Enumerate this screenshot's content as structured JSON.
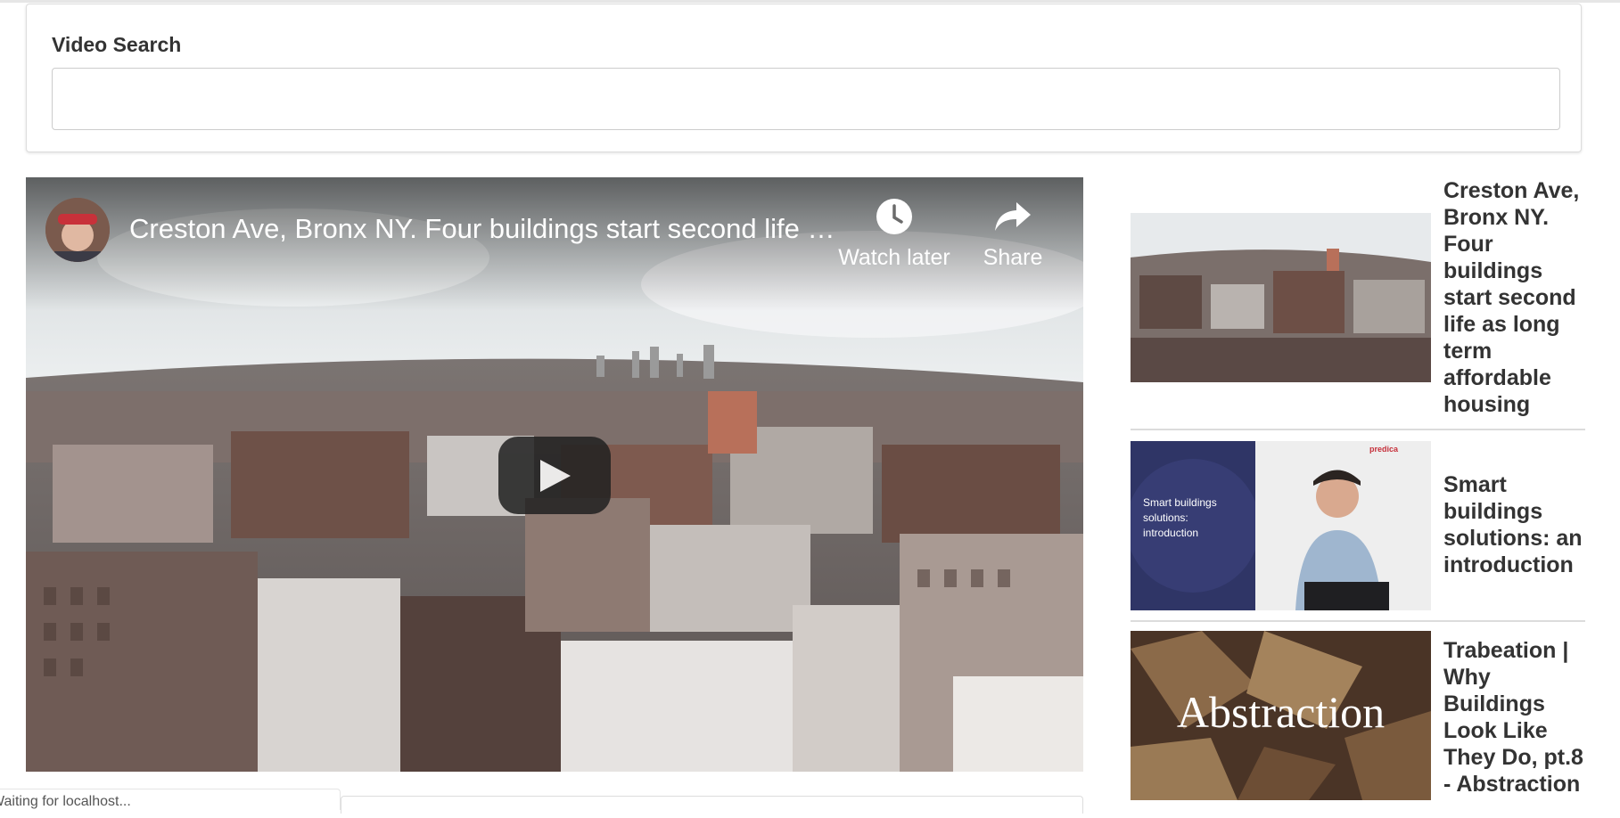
{
  "search": {
    "label": "Video Search",
    "value": "",
    "placeholder": ""
  },
  "player": {
    "title": "Creston Ave, Bronx NY. Four buildings start second life as long term affordable housing",
    "watch_later_label": "Watch later",
    "share_label": "Share",
    "icons": [
      "clock-icon",
      "share-icon",
      "play-icon"
    ]
  },
  "video_list": [
    {
      "title": "Creston Ave, Bronx NY. Four buildings start second life as long term affordable housing"
    },
    {
      "title": "Smart buildings solutions: an introduction",
      "thumb_caption": "Smart buildings solutions: introduction",
      "thumb_brand": "predica"
    },
    {
      "title": "Trabeation | Why Buildings Look Like They Do, pt.8 - Abstraction",
      "thumb_caption": "Abstraction"
    }
  ],
  "status": {
    "text": "Waiting for localhost..."
  },
  "colors": {
    "text": "#333333",
    "border": "#dddddd",
    "play": "#212121"
  }
}
